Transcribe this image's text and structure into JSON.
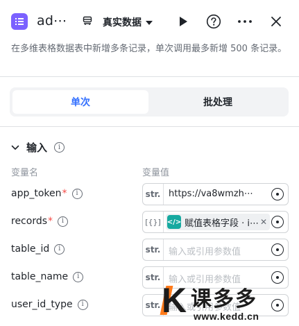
{
  "header": {
    "title": "ad⋯",
    "environment": "真实数据",
    "app_icon": "list-icon",
    "env_icon": "database-icon"
  },
  "description": "在多维表格数据表中新增多条记录，单次调用最多新增 500 条记录。",
  "mode_tabs": {
    "single": "单次",
    "batch": "批处理",
    "active": "single"
  },
  "input_section": {
    "title": "输入",
    "col_name": "变量名",
    "col_value": "变量值",
    "params": [
      {
        "name": "app_token",
        "required": true,
        "type": "str.",
        "value": "https://va8wmzh⋯",
        "placeholder": ""
      },
      {
        "name": "records",
        "required": true,
        "type": "[{}]",
        "chip_label": "赋值表格字段 · i⋯",
        "chip_icon": "code-icon"
      },
      {
        "name": "table_id",
        "required": false,
        "type": "str.",
        "value": "",
        "placeholder": "输入或引用参数值"
      },
      {
        "name": "table_name",
        "required": false,
        "type": "str.",
        "value": "",
        "placeholder": "输入或引用参数值"
      },
      {
        "name": "user_id_type",
        "required": false,
        "type": "str.",
        "value": "",
        "placeholder": "输入或引用参数值"
      }
    ]
  },
  "watermark": {
    "letter": "K",
    "brand": "课多多",
    "url": "www.kedd.cn"
  },
  "colors": {
    "accent": "#3370ff",
    "app_icon_bg": "#7b61ff",
    "required": "#f54a45",
    "chip_icon_bg": "#16a9a0",
    "watermark_accent": "#ff7a1a"
  }
}
